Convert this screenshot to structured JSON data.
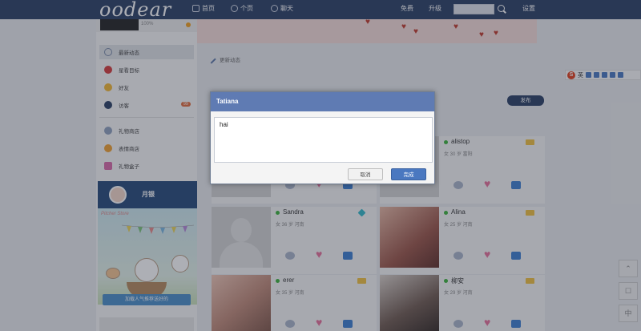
{
  "header": {
    "logo": "oodear",
    "nav": {
      "home": "首页",
      "mine": "个页",
      "chat": "聊天"
    },
    "right": {
      "item1": "免费",
      "item2": "升级",
      "settings": "设置"
    },
    "search": {
      "placeholder": ""
    }
  },
  "sidebar": {
    "profile_text": "100%",
    "items": [
      {
        "label": "最新动态",
        "badge": ""
      },
      {
        "label": "星看目标",
        "badge": ""
      },
      {
        "label": "好友",
        "badge": ""
      },
      {
        "label": "访客",
        "badge": "99"
      },
      {
        "label": "礼物商店",
        "badge": ""
      },
      {
        "label": "表情商店",
        "badge": ""
      },
      {
        "label": "礼物盒子",
        "badge": ""
      }
    ],
    "promo": {
      "label": "月银",
      "art_label": "Pitcher Store",
      "button": "加载人气推荐送好的"
    }
  },
  "main": {
    "status_label": "更新动态",
    "publish": "发布",
    "cards": [
      {
        "name": "",
        "info": ""
      },
      {
        "name": "alistop",
        "info": "女 30 岁 富阳"
      },
      {
        "name": "Sandra",
        "info": "女 36 岁 河南"
      },
      {
        "name": "Alina",
        "info": "女 25 岁 河南"
      },
      {
        "name": "erer",
        "info": "女 35 岁 河南"
      },
      {
        "name": "柳安",
        "info": "女 29 岁 河南"
      }
    ]
  },
  "dialog": {
    "title": "Tatiana",
    "text": "hai",
    "cancel": "取消",
    "ok": "完成"
  },
  "ime": {
    "label": "英"
  },
  "side_buttons": {
    "bottom": "中"
  },
  "colors": {
    "header": "#2b3f64",
    "dialog_title": "#5f7bb3",
    "primary_button": "#4a78c0",
    "online": "#3cb43c",
    "heart": "#e6709a"
  }
}
